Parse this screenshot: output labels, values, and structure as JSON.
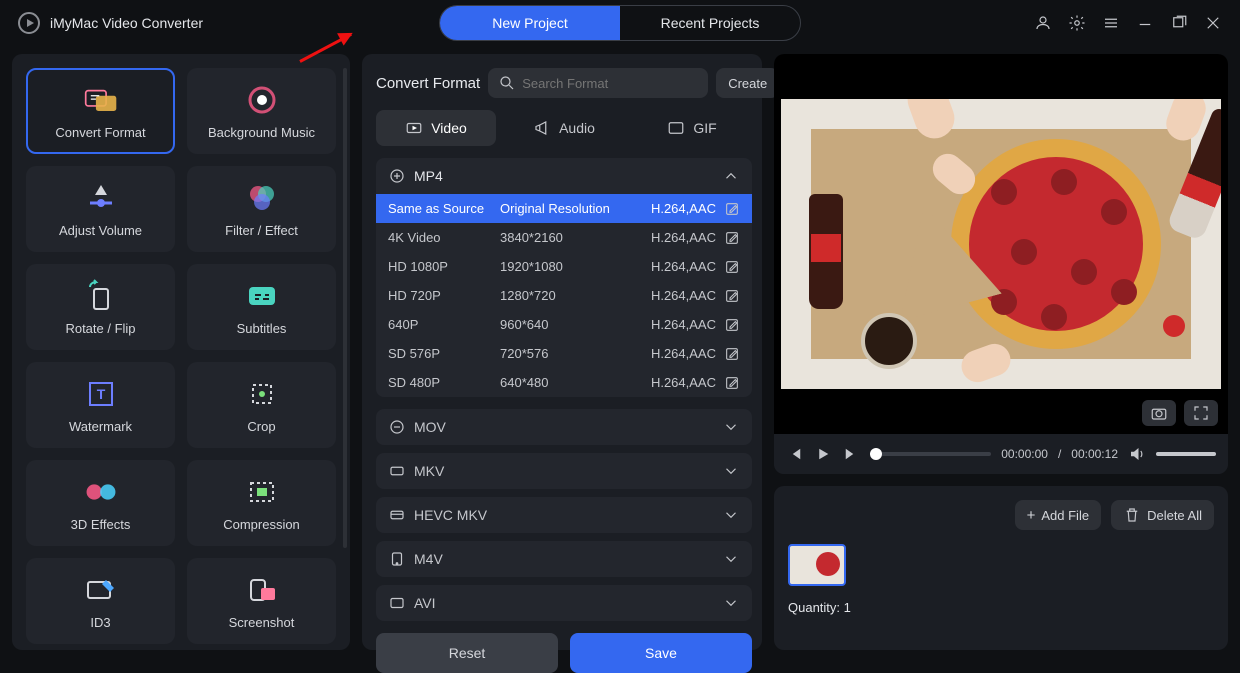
{
  "app_title": "iMyMac Video Converter",
  "project_tabs": {
    "new": "New Project",
    "recent": "Recent Projects"
  },
  "tools": [
    "Convert Format",
    "Background Music",
    "Adjust Volume",
    "Filter / Effect",
    "Rotate / Flip",
    "Subtitles",
    "Watermark",
    "Crop",
    "3D Effects",
    "Compression",
    "ID3",
    "Screenshot"
  ],
  "format_panel": {
    "title": "Convert Format",
    "search_placeholder": "Search Format",
    "create_label": "Create",
    "type_tabs": {
      "video": "Video",
      "audio": "Audio",
      "gif": "GIF"
    },
    "mp4_head": "MP4",
    "presets": [
      {
        "name": "Same as Source",
        "res": "Original Resolution",
        "codec": "H.264,AAC",
        "selected": true
      },
      {
        "name": "4K Video",
        "res": "3840*2160",
        "codec": "H.264,AAC"
      },
      {
        "name": "HD 1080P",
        "res": "1920*1080",
        "codec": "H.264,AAC"
      },
      {
        "name": "HD 720P",
        "res": "1280*720",
        "codec": "H.264,AAC"
      },
      {
        "name": "640P",
        "res": "960*640",
        "codec": "H.264,AAC"
      },
      {
        "name": "SD 576P",
        "res": "720*576",
        "codec": "H.264,AAC"
      },
      {
        "name": "SD 480P",
        "res": "640*480",
        "codec": "H.264,AAC"
      }
    ],
    "other_groups": [
      "MOV",
      "MKV",
      "HEVC MKV",
      "M4V",
      "AVI"
    ],
    "reset": "Reset",
    "save": "Save"
  },
  "player": {
    "current": "00:00:00",
    "total": "00:00:12",
    "sep": " / "
  },
  "files": {
    "add": "Add File",
    "delete": "Delete All",
    "quantity_label": "Quantity: ",
    "quantity": "1"
  }
}
